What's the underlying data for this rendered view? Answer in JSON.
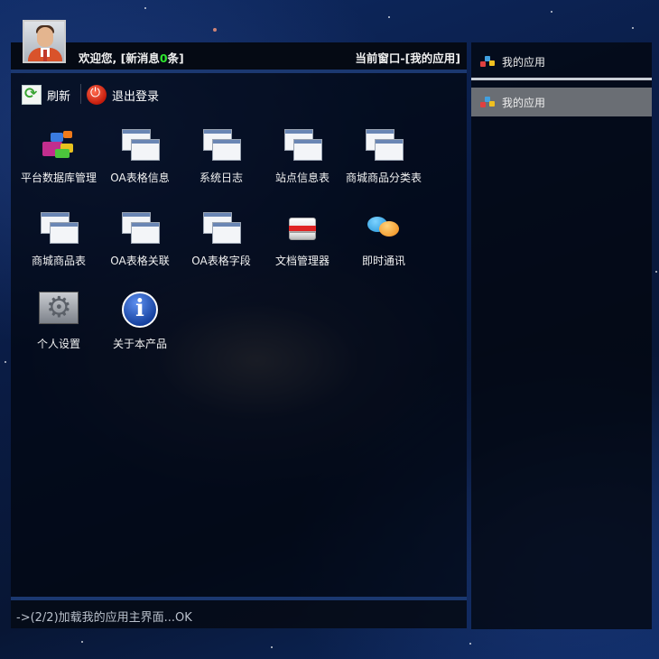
{
  "header": {
    "welcome_prefix": "欢迎您, [新消息",
    "message_count": "0",
    "welcome_suffix": "条]",
    "current_window": "当前窗口-[我的应用]"
  },
  "toolbar": {
    "refresh_label": "刷新",
    "logout_label": "退出登录"
  },
  "apps": [
    {
      "label": "平台数据库管理",
      "icon": "database-icon"
    },
    {
      "label": "OA表格信息",
      "icon": "window-icon"
    },
    {
      "label": "系统日志",
      "icon": "window-icon"
    },
    {
      "label": "站点信息表",
      "icon": "window-icon"
    },
    {
      "label": "商城商品分类表",
      "icon": "window-icon"
    },
    {
      "label": "商城商品表",
      "icon": "window-icon"
    },
    {
      "label": "OA表格关联",
      "icon": "window-icon"
    },
    {
      "label": "OA表格字段",
      "icon": "window-icon"
    },
    {
      "label": "文档管理器",
      "icon": "drive-icon"
    },
    {
      "label": "即时通讯",
      "icon": "chat-icon"
    },
    {
      "label": "个人设置",
      "icon": "settings-icon"
    },
    {
      "label": "关于本产品",
      "icon": "info-icon"
    }
  ],
  "status": {
    "text": "->(2/2)加载我的应用主界面...OK"
  },
  "sidebar": {
    "title": "我的应用",
    "items": [
      {
        "label": "我的应用",
        "selected": true
      }
    ]
  },
  "colors": {
    "message_count": "#2ee52e",
    "panel_border": "#1b3870",
    "selected_item": "#6a6e74"
  }
}
